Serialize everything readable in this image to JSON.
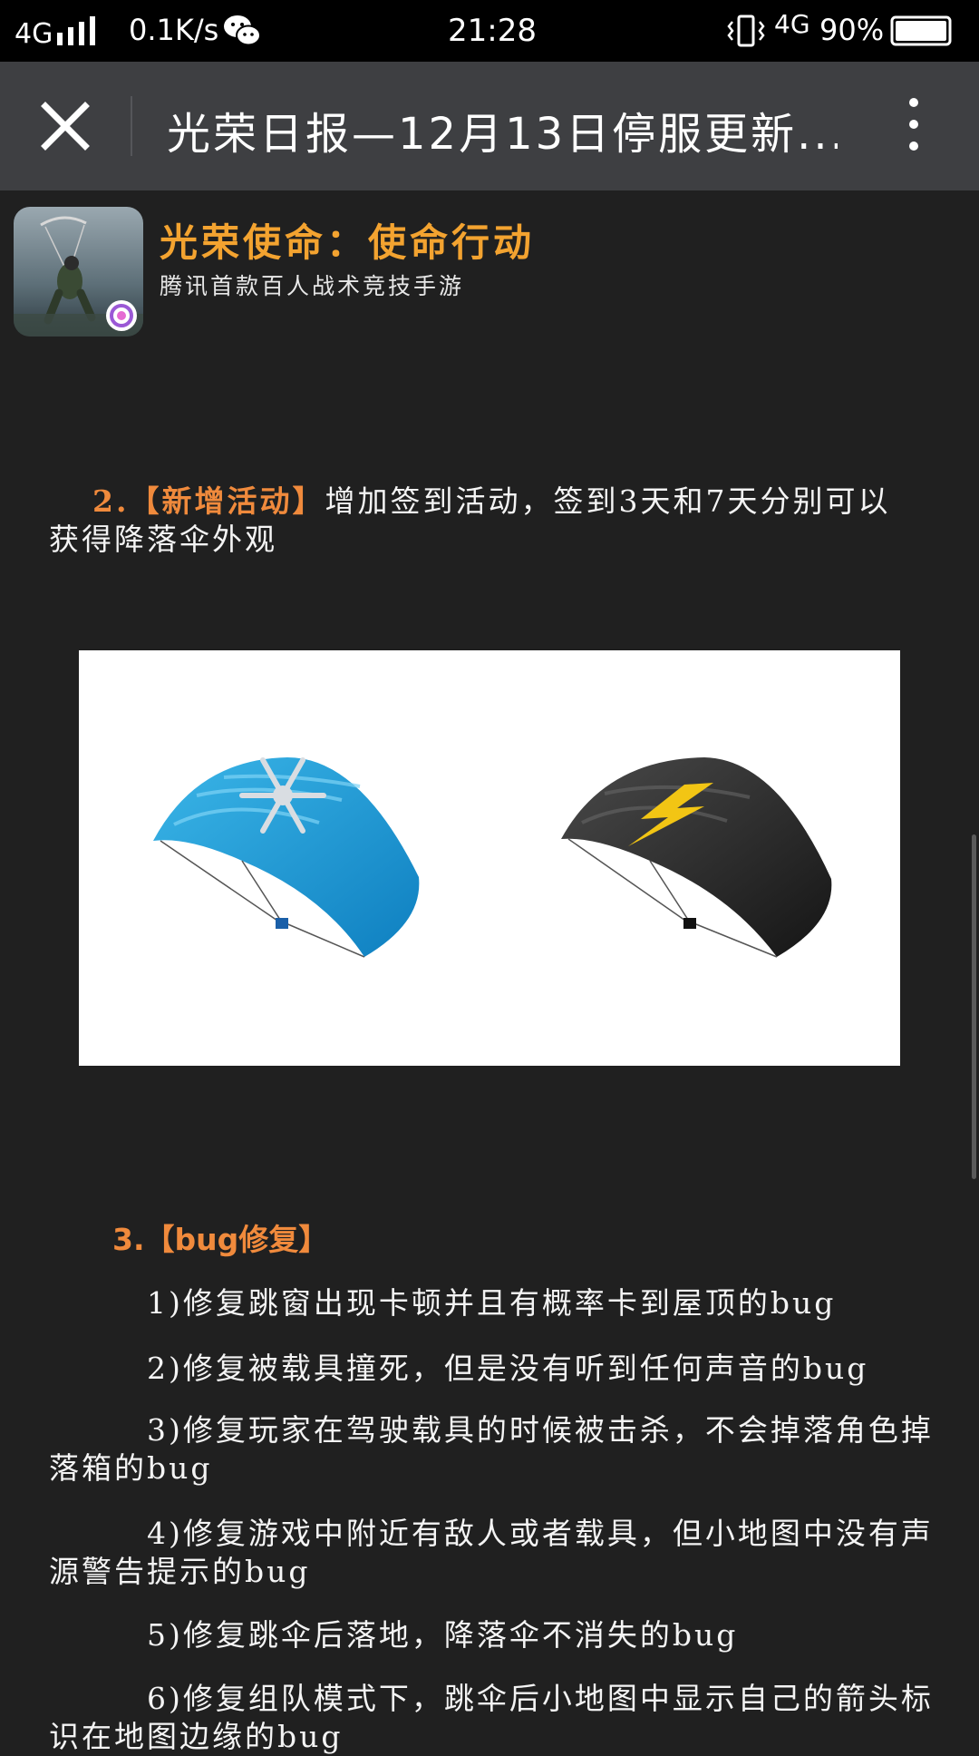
{
  "status_bar": {
    "network": "4G",
    "speed": "0.1K/s",
    "time": "21:28",
    "network2": "4G",
    "battery": "90%"
  },
  "title_bar": {
    "title": "光荣日报—12月13日停服更新..."
  },
  "banner": {
    "game_name": "光荣使命：使命行动",
    "tagline": "腾讯首款百人战术竞技手游"
  },
  "article": {
    "item2_number": "2.",
    "item2_tag": "【新增活动】",
    "item2_text": "增加签到活动，签到3天和7天分别可以获得降落伞外观",
    "section3_title": "3.【bug修复】",
    "bug_items": [
      "1)修复跳窗出现卡顿并且有概率卡到屋顶的bug",
      "2)修复被载具撞死，但是没有听到任何声音的bug",
      "3)修复玩家在驾驶载具的时候被击杀，不会掉落角色掉落箱的bug",
      "4)修复游戏中附近有敌人或者载具，但小地图中没有声源警告提示的bug",
      "5)修复跳伞后落地，降落伞不消失的bug",
      "6)修复组队模式下，跳伞后小地图中显示自己的箭头标识在地图边缘的bug"
    ]
  },
  "colors": {
    "accent_orange": "#f08a3c",
    "game_name_gold": "#f3a330",
    "background": "#202020",
    "title_bar": "#3e3f42"
  },
  "icons": [
    "signal-icon",
    "wechat-icon",
    "vibrate-icon",
    "battery-icon",
    "close-icon",
    "more-icon",
    "parachute-snowflake-image",
    "parachute-lightning-image"
  ]
}
